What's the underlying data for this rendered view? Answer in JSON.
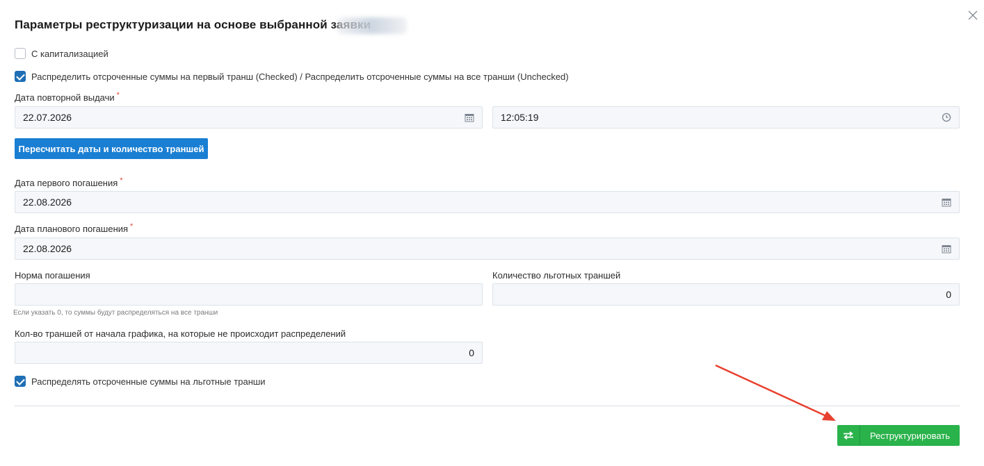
{
  "dialog": {
    "title": "Параметры реструктуризации на основе выбранной заявки",
    "close_icon": "close-icon"
  },
  "checkboxes": {
    "capitalization": {
      "label": "С капитализацией",
      "checked": false
    },
    "distribute_first": {
      "label": "Распределить отсроченные суммы на первый транш (Checked) / Распределить отсроченные суммы на все транши (Unchecked)",
      "checked": true
    },
    "distribute_grace": {
      "label": "Распределять отсроченные суммы на льготные транши",
      "checked": true
    }
  },
  "reissue": {
    "label": "Дата повторной выдачи",
    "required_mark": "*",
    "date_value": "22.07.2026",
    "time_value": "12:05:19",
    "date_icon": "calendar-icon",
    "time_icon": "clock-icon"
  },
  "recalc_button": {
    "label": "Пересчитать даты и количество траншей"
  },
  "first_payment": {
    "label": "Дата первого погашения",
    "required_mark": "*",
    "value": "22.08.2026",
    "icon": "calendar-icon"
  },
  "planned_payment": {
    "label": "Дата планового погашения",
    "required_mark": "*",
    "value": "22.08.2026",
    "icon": "calendar-icon"
  },
  "repayment_rate": {
    "label": "Норма погашения",
    "value": "",
    "hint": "Если указать 0, то суммы будут распределяться на все транши"
  },
  "grace_tranches": {
    "label": "Количество льготных траншей",
    "value": "0"
  },
  "skip_tranches": {
    "label": "Кол-во траншей от начала графика, на которые не происходит распределений",
    "value": "0"
  },
  "restructure_button": {
    "label": "Реструктурировать",
    "icon": "swap-arrows-icon"
  },
  "colors": {
    "primary": "#1a7fd3",
    "success": "#2ab24b",
    "required": "#e04a3b",
    "annotation_arrow": "#e8402f",
    "checkbox_checked": "#1f6fb5"
  }
}
